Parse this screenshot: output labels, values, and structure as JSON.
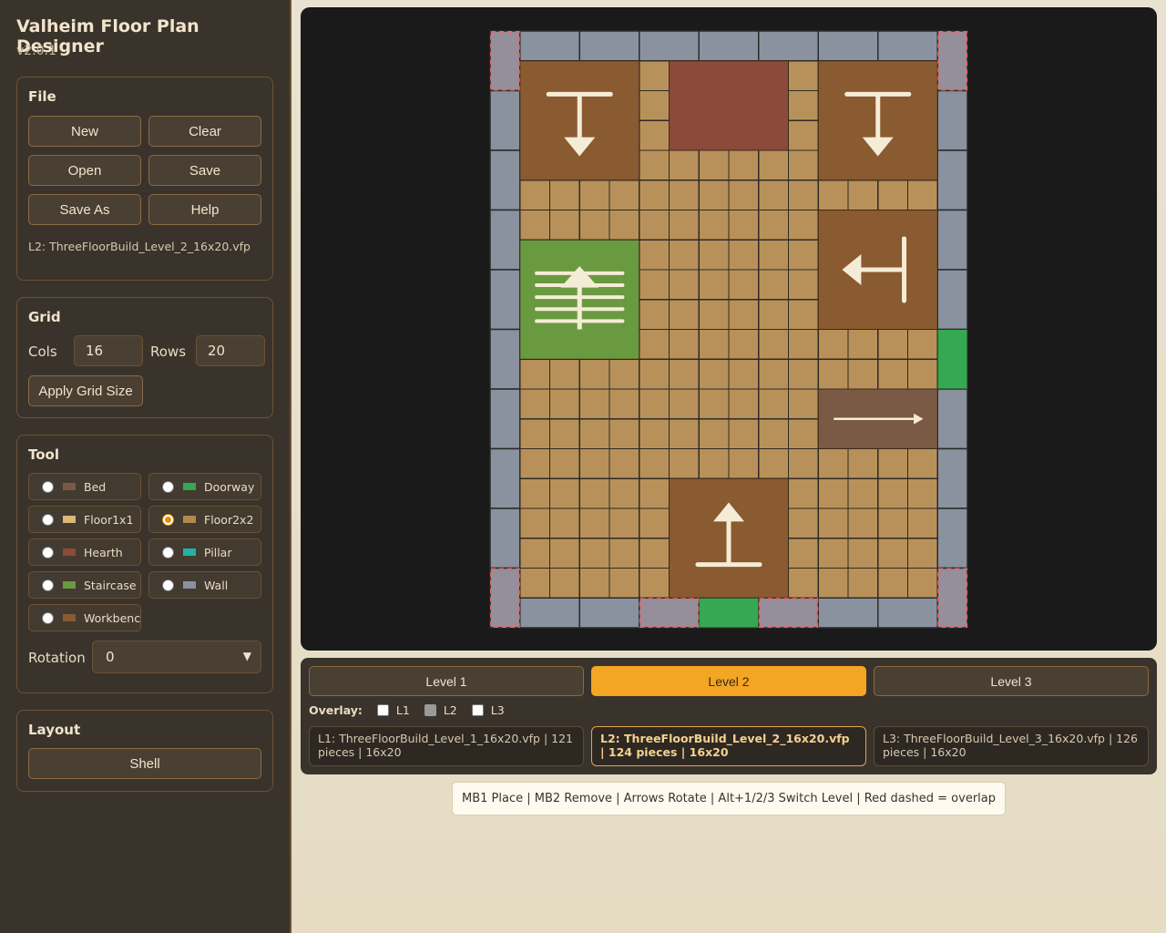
{
  "app": {
    "title": "Valheim Floor Plan Designer",
    "version": "v2.0.1"
  },
  "file": {
    "title": "File",
    "buttons": [
      "New",
      "Clear",
      "Open",
      "Save",
      "Save As",
      "Help"
    ],
    "current": "L2: ThreeFloorBuild_Level_2_16x20.vfp"
  },
  "grid": {
    "title": "Grid",
    "cols_label": "Cols",
    "cols": "16",
    "rows_label": "Rows",
    "rows": "20",
    "apply_label": "Apply Grid Size"
  },
  "tool": {
    "title": "Tool",
    "items": [
      {
        "label": "Bed",
        "color": "#7a5a45",
        "selected": false
      },
      {
        "label": "Doorway",
        "color": "#34a853",
        "selected": false
      },
      {
        "label": "Floor1x1",
        "color": "#d9b87a",
        "selected": false
      },
      {
        "label": "Floor2x2",
        "color": "#b08850",
        "selected": true
      },
      {
        "label": "Hearth",
        "color": "#8b4a3a",
        "selected": false
      },
      {
        "label": "Pillar",
        "color": "#20b2a8",
        "selected": false
      },
      {
        "label": "Staircase",
        "color": "#6a9a40",
        "selected": false
      },
      {
        "label": "Wall",
        "color": "#8a92a0",
        "selected": false
      },
      {
        "label": "Workbench",
        "color": "#8a5a30",
        "selected": false
      }
    ],
    "rotation_label": "Rotation",
    "rotation_value": "0"
  },
  "layout": {
    "title": "Layout",
    "button": "Shell"
  },
  "levels": {
    "buttons": [
      "Level 1",
      "Level 2",
      "Level 3"
    ],
    "active_index": 1,
    "overlay_label": "Overlay:",
    "overlay": [
      {
        "label": "L1",
        "checked": false,
        "disabled": false
      },
      {
        "label": "L2",
        "checked": false,
        "disabled": true
      },
      {
        "label": "L3",
        "checked": false,
        "disabled": false
      }
    ],
    "info": [
      "L1: ThreeFloorBuild_Level_1_16x20.vfp | 121 pieces | 16x20",
      "L2: ThreeFloorBuild_Level_2_16x20.vfp | 124 pieces | 16x20",
      "L3: ThreeFloorBuild_Level_3_16x20.vfp | 126 pieces | 16x20"
    ]
  },
  "hint": "MB1 Place | MB2 Remove | Arrows Rotate | Alt+1/2/3 Switch Level | Red dashed = overlap",
  "colors": {
    "wall": "#8a92a0",
    "floor": "#b8915a",
    "bed": "#7a5a45",
    "hearth": "#8b4a3a",
    "staircase": "#6a9a40",
    "workbench": "#8a5a30",
    "doorway": "#34a853",
    "accent": "#f3a524"
  },
  "floor_plan": {
    "cols": 16,
    "rows": 20,
    "pieces": [
      {
        "type": "workbench",
        "col": 1,
        "row": 1,
        "w": 4,
        "h": 4,
        "arrow": "down"
      },
      {
        "type": "hearth",
        "col": 6,
        "row": 1,
        "w": 4,
        "h": 3
      },
      {
        "type": "workbench",
        "col": 11,
        "row": 1,
        "w": 4,
        "h": 4,
        "arrow": "down"
      },
      {
        "type": "staircase",
        "col": 1,
        "row": 7,
        "w": 4,
        "h": 4,
        "arrow": "up"
      },
      {
        "type": "workbench",
        "col": 11,
        "row": 6,
        "w": 4,
        "h": 4,
        "arrow": "left"
      },
      {
        "type": "bed",
        "col": 11,
        "row": 12,
        "w": 4,
        "h": 2,
        "arrow": "right"
      },
      {
        "type": "workbench",
        "col": 6,
        "row": 15,
        "w": 4,
        "h": 4,
        "arrow": "up"
      },
      {
        "type": "doorway",
        "col": 15,
        "row": 10,
        "w": 1,
        "h": 2
      },
      {
        "type": "doorway",
        "col": 7,
        "row": 19,
        "w": 2,
        "h": 1
      }
    ],
    "overlaps": [
      {
        "col": 0,
        "row": 0,
        "w": 1,
        "h": 2
      },
      {
        "col": 15,
        "row": 0,
        "w": 1,
        "h": 2
      },
      {
        "col": 0,
        "row": 18,
        "w": 1,
        "h": 2
      },
      {
        "col": 15,
        "row": 18,
        "w": 1,
        "h": 2
      },
      {
        "col": 5,
        "row": 19,
        "w": 2,
        "h": 1
      },
      {
        "col": 9,
        "row": 19,
        "w": 2,
        "h": 1
      }
    ]
  }
}
